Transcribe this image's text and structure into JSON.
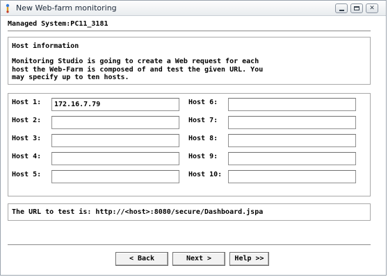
{
  "window": {
    "title": "New Web-farm monitoring",
    "minimize_glyph": "",
    "maximize_glyph": "",
    "close_glyph": "✕"
  },
  "header": {
    "managed_system": "Managed System:PC11_3181"
  },
  "info": {
    "heading": "Host information",
    "body": "Monitoring Studio is going to create a Web request for each\nhost the Web-Farm is composed of and test the given URL. You\nmay specify up to ten hosts."
  },
  "hosts": [
    {
      "label": "Host 1:",
      "value": "172.16.7.79"
    },
    {
      "label": "Host 2:",
      "value": ""
    },
    {
      "label": "Host 3:",
      "value": ""
    },
    {
      "label": "Host 4:",
      "value": ""
    },
    {
      "label": "Host 5:",
      "value": ""
    },
    {
      "label": "Host 6:",
      "value": ""
    },
    {
      "label": "Host 7:",
      "value": ""
    },
    {
      "label": "Host 8:",
      "value": ""
    },
    {
      "label": "Host 9:",
      "value": ""
    },
    {
      "label": "Host 10:",
      "value": ""
    }
  ],
  "url": {
    "text": "The URL to test is: http://<host>:8080/secure/Dashboard.jspa"
  },
  "buttons": {
    "back": "< Back",
    "next": "Next >",
    "help": "Help >>"
  },
  "icons": {
    "app": "app-icon",
    "minimize": "minimize-icon",
    "maximize": "maximize-icon",
    "close": "close-icon"
  }
}
